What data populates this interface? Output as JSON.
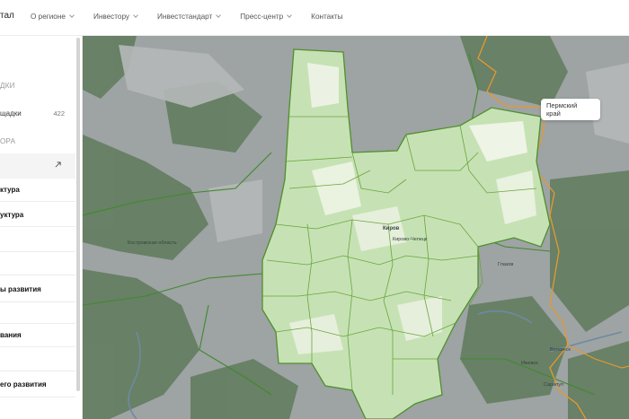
{
  "header": {
    "brand_fragment": "тал",
    "nav": [
      {
        "label": "О регионе",
        "has_dropdown": true
      },
      {
        "label": "Инвестору",
        "has_dropdown": true
      },
      {
        "label": "Инвестстандарт",
        "has_dropdown": true
      },
      {
        "label": "Пресс-центр",
        "has_dropdown": true
      },
      {
        "label": "Контакты",
        "has_dropdown": false
      }
    ]
  },
  "sidebar": {
    "section1": "ДКИ",
    "item_sites": {
      "label": "щадки",
      "count": "422"
    },
    "section2": "ОРА",
    "items": [
      "ктура",
      "уктура",
      "ы развития",
      "вания",
      "его развития"
    ]
  },
  "map": {
    "tooltip": {
      "line1": "Пермский",
      "line2": "край"
    },
    "cities": {
      "kirov": "Киров",
      "kirov_small": "Кирово-Чепецк",
      "glazov": "Глазов",
      "izhevsk": "Ижевск",
      "votkinsk": "Воткинск",
      "sarapul": "Сарапул",
      "kostroma_obl": "Костромская область"
    },
    "colors": {
      "land": "#9ea3a4",
      "forest": "#5c7a5a",
      "region_fill": "#c9e4b8",
      "region_light": "#eef4e6",
      "region_border": "#5e9a34",
      "perm_border": "#e59a2e",
      "neighbor_border": "#3f8a2c"
    }
  }
}
